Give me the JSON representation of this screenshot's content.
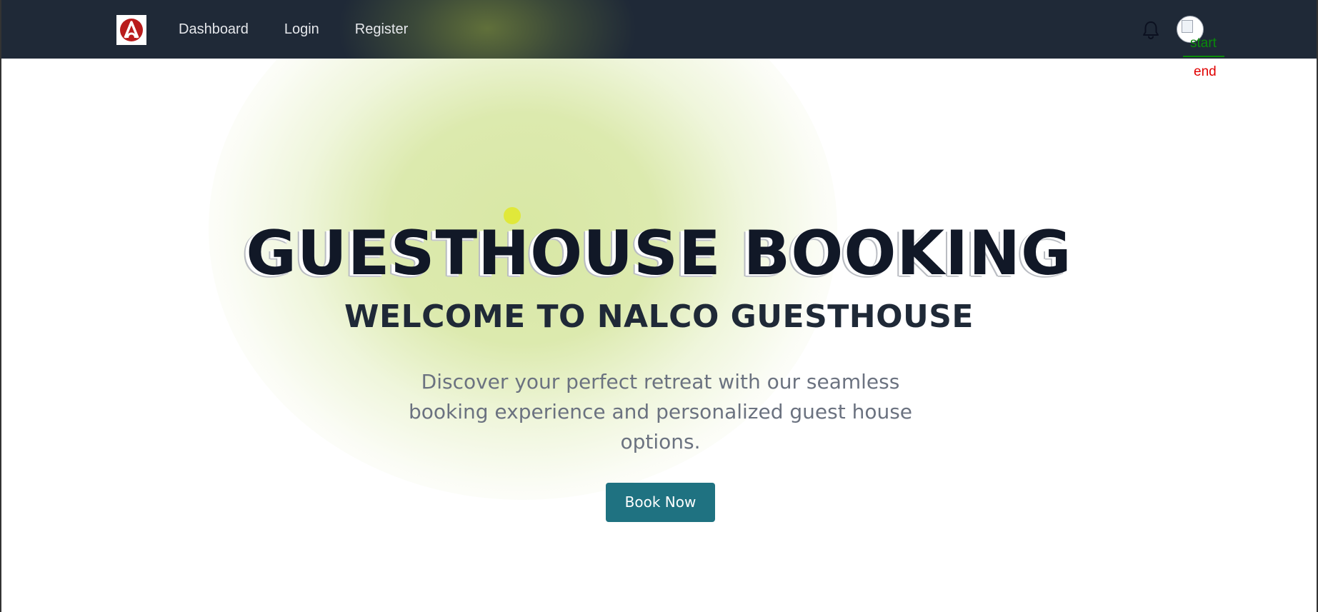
{
  "nav": {
    "links": [
      {
        "label": "Dashboard"
      },
      {
        "label": "Login"
      },
      {
        "label": "Register"
      }
    ],
    "logo_icon": "nalco-logo",
    "bell_icon": "bell-icon",
    "avatar_icon": "avatar"
  },
  "markers": {
    "start": "start",
    "end": "end"
  },
  "hero": {
    "title": "GUESTHOUSE BOOKING",
    "subtitle": "WELCOME TO NALCO GUESTHOUSE",
    "description": "Discover your perfect retreat with our seamless booking experience and personalized guest house options.",
    "cta_label": "Book Now"
  },
  "colors": {
    "navbar": "#1f2937",
    "cta": "#1f7281",
    "title": "#111827",
    "description": "#6b7280",
    "logo_red": "#b91c1c"
  }
}
